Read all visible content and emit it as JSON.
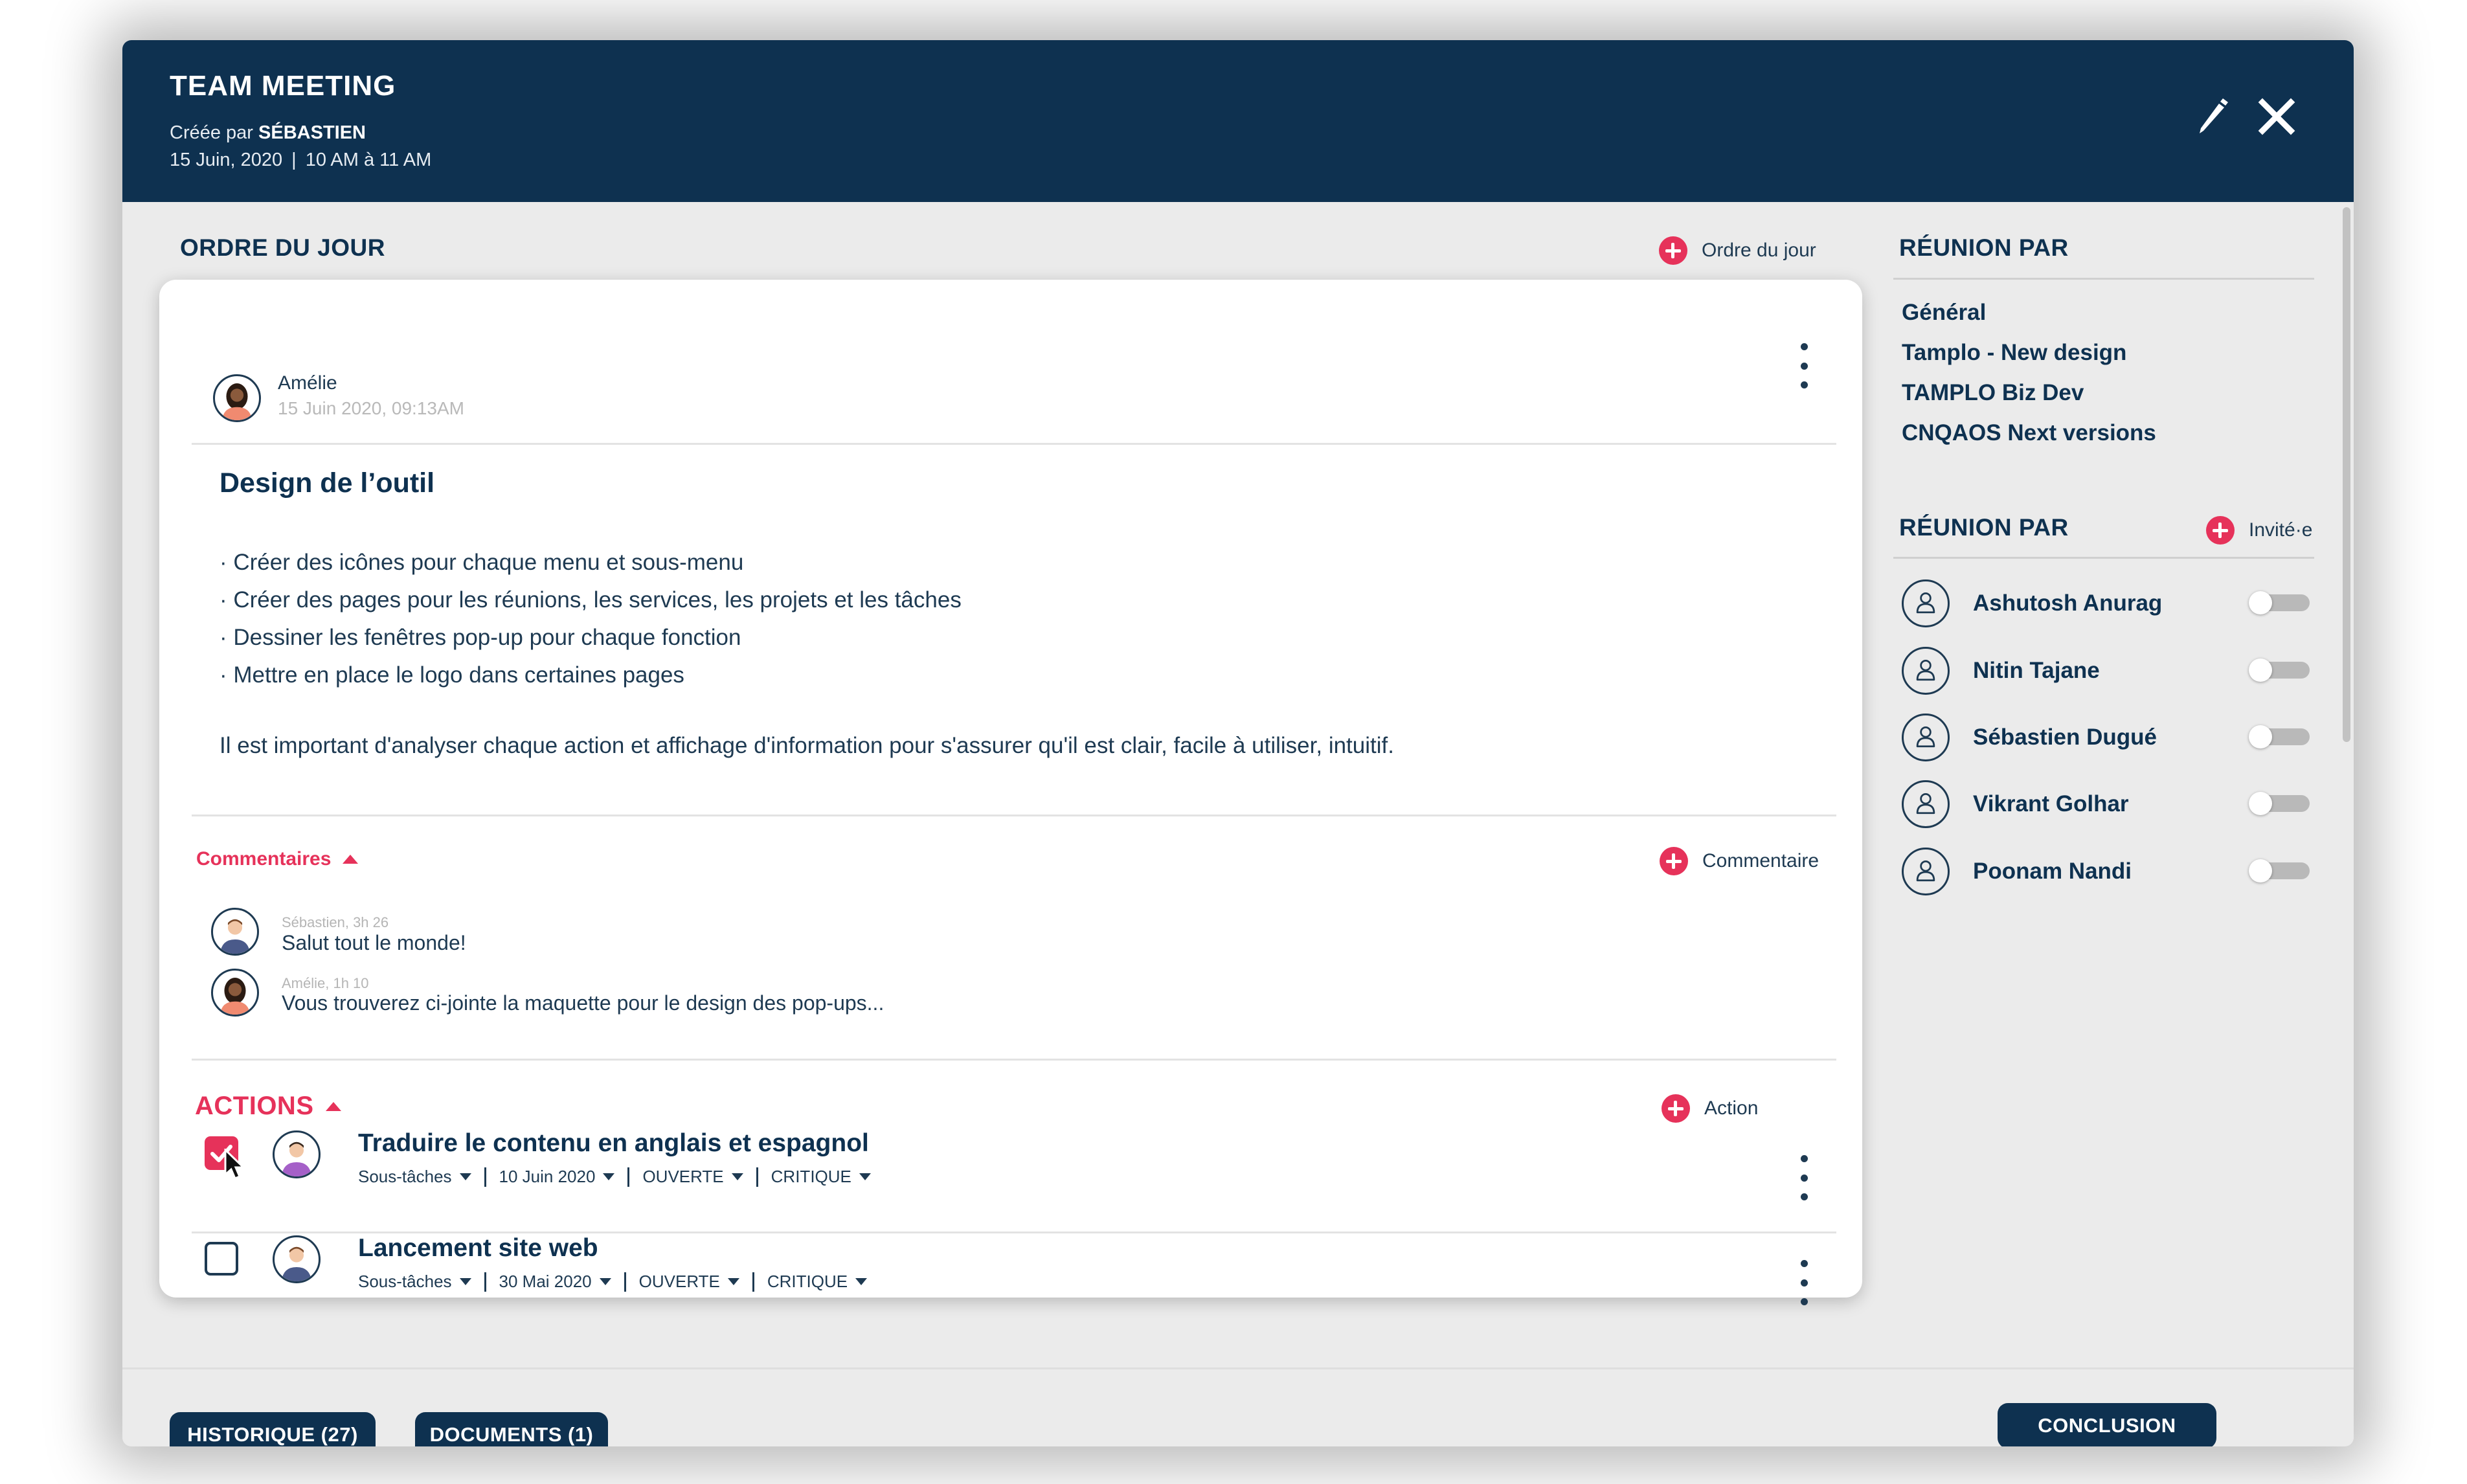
{
  "header": {
    "title": "TEAM MEETING",
    "created_by_prefix": "Créée par",
    "creator": "SÉBASTIEN",
    "date": "15 Juin, 2020",
    "separator": "|",
    "time": "10 AM à 11 AM",
    "edit_icon": "pencil-icon",
    "close_icon": "close-icon"
  },
  "agenda": {
    "section_title": "ORDRE DU JOUR",
    "add_label": "Ordre du jour",
    "author": "Amélie",
    "author_date": "15 Juin 2020, 09:13AM",
    "title": "Design de l’outil",
    "bullets": [
      "· Créer des icônes pour chaque menu et sous-menu",
      "· Créer des pages pour les réunions, les services, les projets et les tâches",
      "· Dessiner les fenêtres pop-up pour chaque fonction",
      "· Mettre en place le logo dans certaines pages"
    ],
    "note": "Il est important d'analyser chaque action et affichage d'information pour s'assurer qu'il est clair, facile à utiliser, intuitif."
  },
  "comments": {
    "label": "Commentaires",
    "add_label": "Commentaire",
    "items": [
      {
        "meta": "Sébastien, 3h 26",
        "text": "Salut tout le monde!"
      },
      {
        "meta": "Amélie, 1h 10",
        "text": "Vous trouverez ci-jointe la maquette pour le design des pop-ups..."
      }
    ]
  },
  "actions": {
    "label": "ACTIONS",
    "add_label": "Action",
    "items": [
      {
        "title": "Traduire le contenu en anglais et espagnol",
        "subtasks": "Sous-tâches",
        "date": "10 Juin 2020",
        "status": "OUVERTE",
        "priority": "CRITIQUE",
        "checked": true
      },
      {
        "title": "Lancement site web",
        "subtasks": "Sous-tâches",
        "date": "30 Mai 2020",
        "status": "OUVERTE",
        "priority": "CRITIQUE",
        "checked": false
      }
    ]
  },
  "meeting_by": {
    "title": "RÉUNION PAR",
    "items": [
      "Général",
      "Tamplo - New design",
      "TAMPLO Biz Dev",
      "CNQAOS Next versions"
    ]
  },
  "participants": {
    "title": "RÉUNION PAR",
    "add_label": "Invité·e",
    "people": [
      "Ashutosh Anurag",
      "Nitin Tajane",
      "Sébastien Dugué",
      "Vikrant Golhar",
      "Poonam Nandi"
    ]
  },
  "footer": {
    "history_label": "HISTORIQUE (27)",
    "documents_label": "DOCUMENTS (1)",
    "conclusion_label": "CONCLUSION"
  },
  "colors": {
    "navy": "#0e3150",
    "accent": "#e6325a",
    "background": "#ebebeb"
  }
}
